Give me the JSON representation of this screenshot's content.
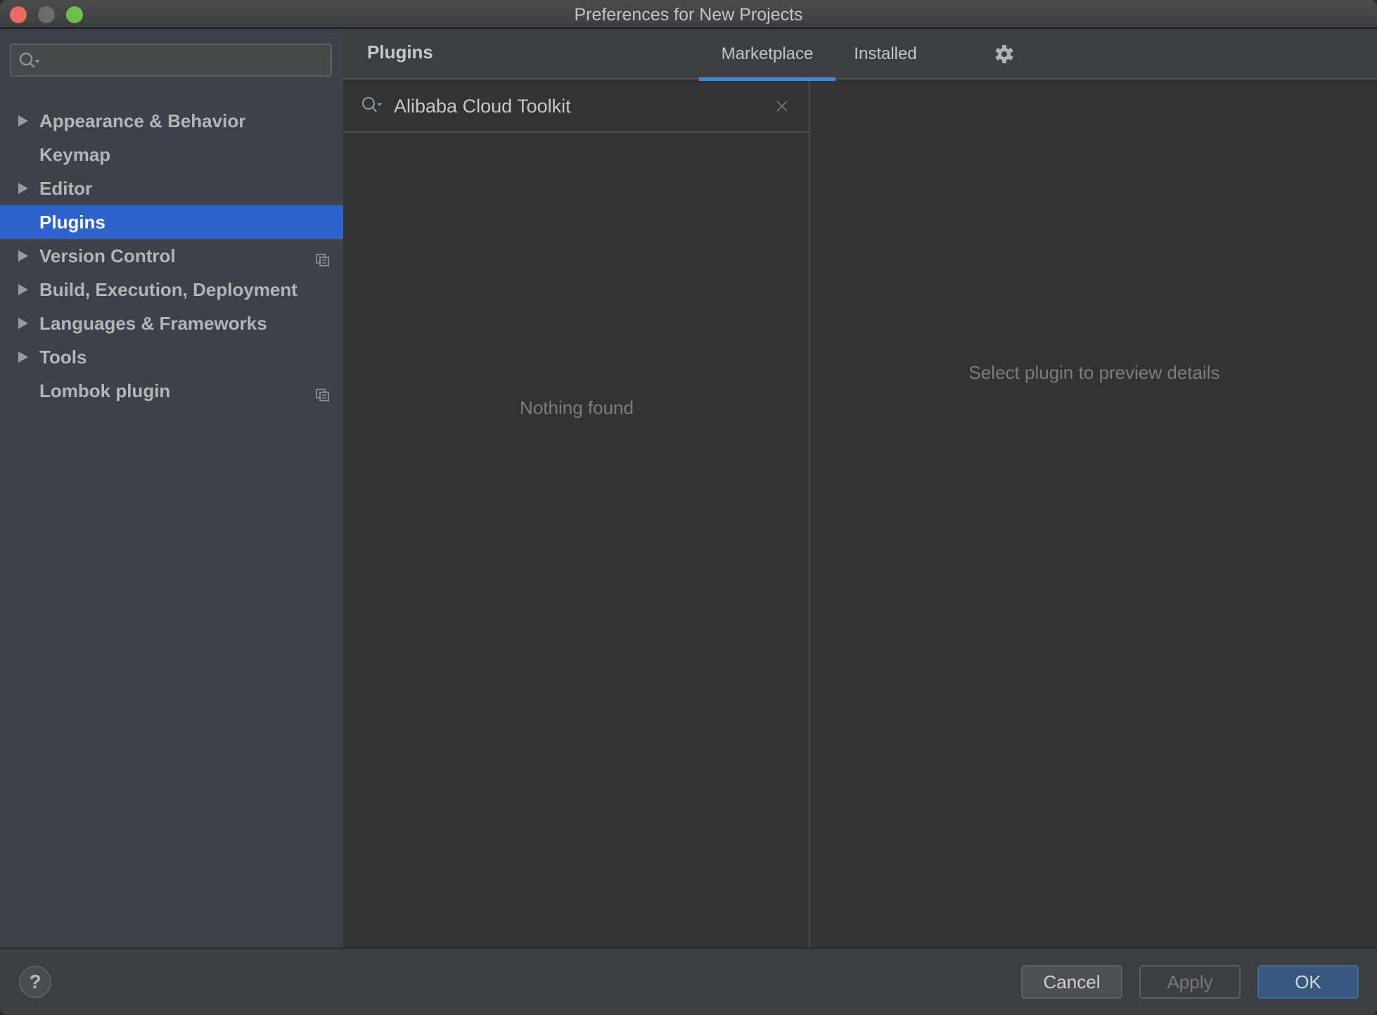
{
  "window": {
    "title": "Preferences for New Projects",
    "controls": [
      "close",
      "minimize",
      "maximize"
    ]
  },
  "sidebar": {
    "search": {
      "value": "",
      "placeholder": ""
    },
    "items": [
      {
        "label": "Appearance & Behavior",
        "expandable": true,
        "selected": false,
        "project_icon": false
      },
      {
        "label": "Keymap",
        "expandable": false,
        "selected": false,
        "project_icon": false
      },
      {
        "label": "Editor",
        "expandable": true,
        "selected": false,
        "project_icon": false
      },
      {
        "label": "Plugins",
        "expandable": false,
        "selected": true,
        "project_icon": false
      },
      {
        "label": "Version Control",
        "expandable": true,
        "selected": false,
        "project_icon": true
      },
      {
        "label": "Build, Execution, Deployment",
        "expandable": true,
        "selected": false,
        "project_icon": false
      },
      {
        "label": "Languages & Frameworks",
        "expandable": true,
        "selected": false,
        "project_icon": false
      },
      {
        "label": "Tools",
        "expandable": true,
        "selected": false,
        "project_icon": false
      },
      {
        "label": "Lombok plugin",
        "expandable": false,
        "selected": false,
        "project_icon": true
      }
    ]
  },
  "main": {
    "title": "Plugins",
    "tabs": [
      {
        "label": "Marketplace",
        "active": true
      },
      {
        "label": "Installed",
        "active": false
      }
    ],
    "settings_icon": "gear-icon",
    "search": {
      "value": "Alibaba Cloud Toolkit",
      "placeholder": ""
    },
    "empty_list_text": "Nothing found",
    "detail_hint": "Select plugin to preview details"
  },
  "footer": {
    "help_label": "?",
    "cancel_label": "Cancel",
    "apply_label": "Apply",
    "ok_label": "OK",
    "apply_enabled": false
  },
  "colors": {
    "selection": "#2e62cc",
    "tab_underline": "#4a88c7",
    "ok_button": "#365880",
    "close": "#ef6a5e",
    "maximize": "#6cc04a"
  }
}
